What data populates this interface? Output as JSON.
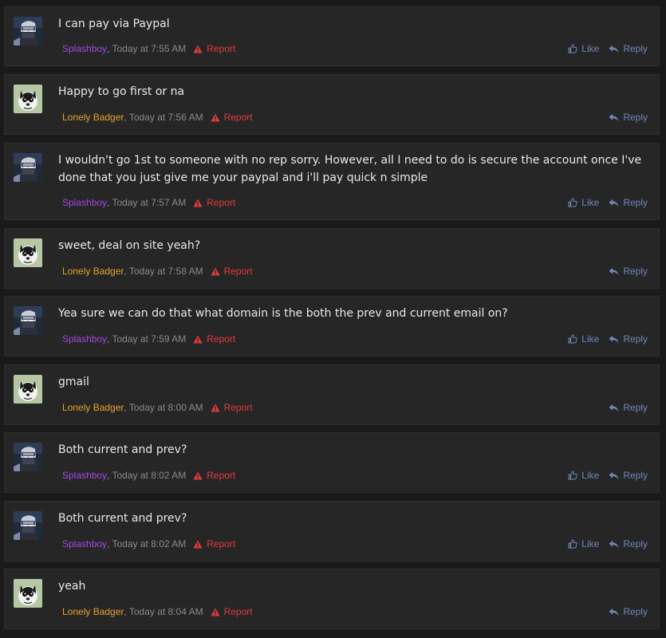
{
  "colors": {
    "background": "#1a1a1a",
    "card": "#262626",
    "text": "#e8e8e8",
    "meta": "#8a8a8a",
    "splashboy": "#a049e3",
    "lonely_badger": "#e5a22a",
    "report": "#e23b3b",
    "action": "#7088b8"
  },
  "labels": {
    "report": "Report",
    "like": "Like",
    "reply": "Reply"
  },
  "messages": [
    {
      "text": "I can pay via Paypal",
      "author": "Splashboy",
      "time": ", Today at 7:55 AM",
      "avatar": "ninja-avatar",
      "like": true
    },
    {
      "text": "Happy to go first or na",
      "author": "Lonely Badger",
      "time": ", Today at 7:56 AM",
      "avatar": "badger-avatar",
      "like": false
    },
    {
      "text": "I wouldn't go 1st to someone with no rep sorry. However, all I need to do is secure the account once I've done that you just give me your paypal and i'll pay quick n simple",
      "author": "Splashboy",
      "time": ", Today at 7:57 AM",
      "avatar": "ninja-avatar",
      "like": true
    },
    {
      "text": "sweet, deal on site yeah?",
      "author": "Lonely Badger",
      "time": ", Today at 7:58 AM",
      "avatar": "badger-avatar",
      "like": false
    },
    {
      "text": "Yea sure we can do that what domain is the both the prev and current email on?",
      "author": "Splashboy",
      "time": ", Today at 7:59 AM",
      "avatar": "ninja-avatar",
      "like": true
    },
    {
      "text": "gmail",
      "author": "Lonely Badger",
      "time": ", Today at 8:00 AM",
      "avatar": "badger-avatar",
      "like": false
    },
    {
      "text": "Both current and prev?",
      "author": "Splashboy",
      "time": ", Today at 8:02 AM",
      "avatar": "ninja-avatar",
      "like": true
    },
    {
      "text": "Both current and prev?",
      "author": "Splashboy",
      "time": ", Today at 8:02 AM",
      "avatar": "ninja-avatar",
      "like": true
    },
    {
      "text": "yeah",
      "author": "Lonely Badger",
      "time": ", Today at 8:04 AM",
      "avatar": "badger-avatar",
      "like": false
    }
  ]
}
